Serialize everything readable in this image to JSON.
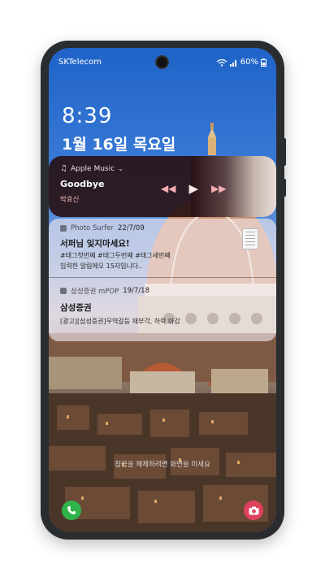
{
  "status": {
    "carrier": "SKTelecom",
    "battery": "60%"
  },
  "lock": {
    "time": "8:39",
    "date": "1월 16일 목요일",
    "unlock_hint": "잠금을 해제하려면 화면을 미세요"
  },
  "music": {
    "source": "Apple Music",
    "title": "Goodbye",
    "artist": "박효신",
    "accent": "#f3a9b0"
  },
  "notifications": [
    {
      "app": "Photo Surfer",
      "time": "22/7/09",
      "title": "서퍼님 잊지마세요!",
      "line1": "#태그첫번째 #태그두번째 #태그세번째",
      "line2": "입력한 알림에오 15자입니다.."
    },
    {
      "app": "삼성증권 mPOP",
      "time": "19/7/18",
      "title": "삼성증권",
      "line1": "[광고][삼성증권]무역갈등 재부각, 하락 마감"
    }
  ],
  "icons": {
    "phone": "phone-icon",
    "camera": "camera-icon"
  }
}
